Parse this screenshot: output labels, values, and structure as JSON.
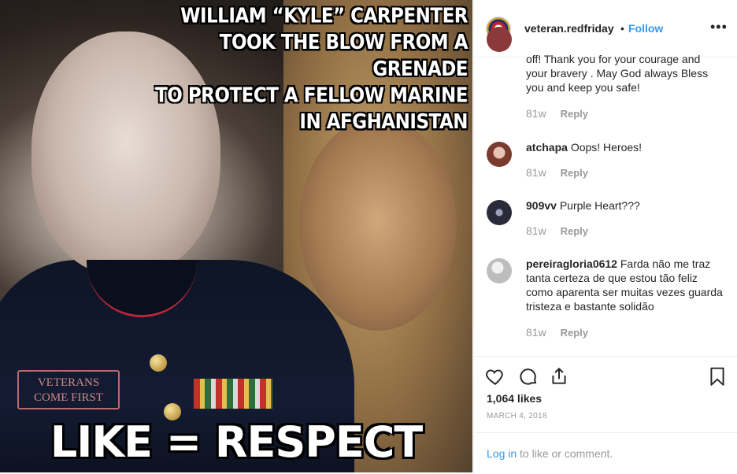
{
  "post": {
    "headline_lines": [
      "WILLIAM “KYLE” CARPENTER",
      "TOOK THE BLOW FROM A GRENADE",
      "TO PROTECT A FELLOW MARINE",
      "IN AFGHANISTAN"
    ],
    "watermark_lines": [
      "VETERANS",
      "COME FIRST"
    ],
    "bottom_caption": "LIKE = RESPECT"
  },
  "header": {
    "username": "veteran.redfriday",
    "separator": "•",
    "follow_label": "Follow",
    "more_icon": "more-options-icon",
    "more_glyph": "•••"
  },
  "comments": [
    {
      "username": "",
      "text": "off! Thank you for your courage and your bravery . May God always Bless you and keep you safe!",
      "time": "81w",
      "reply_label": "Reply",
      "avatar_color": "#8a3a3a"
    },
    {
      "username": "atchapa",
      "text": "Oops! Heroes!",
      "time": "81w",
      "reply_label": "Reply",
      "avatar_color": "#a45f54"
    },
    {
      "username": "909vv",
      "text": "Purple Heart???",
      "time": "81w",
      "reply_label": "Reply",
      "avatar_color": "#2a2a3a"
    },
    {
      "username": "pereiragloria0612",
      "text": "Farda não me traz tanta certeza de que estou tão feliz como aparenta ser muitas vezes guarda tristeza e bastante solidão",
      "time": "81w",
      "reply_label": "Reply",
      "avatar_color": "#c9c9c9"
    }
  ],
  "footer": {
    "likes": "1,064 likes",
    "date": "MARCH 4, 2018",
    "login_link": "Log in",
    "login_rest": " to like or comment."
  },
  "colors": {
    "link_blue": "#3897f0",
    "text": "#262626",
    "muted": "#999999"
  }
}
